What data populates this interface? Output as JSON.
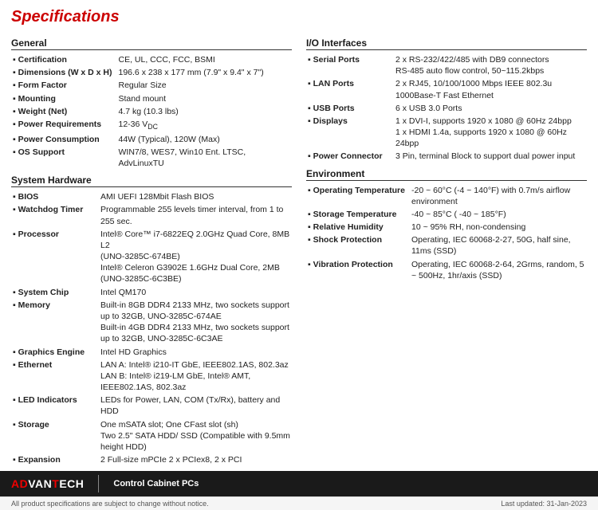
{
  "title": "Specifications",
  "left_col": {
    "sections": [
      {
        "title": "General",
        "rows": [
          {
            "label": "Certification",
            "value": "CE, UL, CCC, FCC, BSMI"
          },
          {
            "label": "Dimensions (W x D x H)",
            "value": "196.6 x 238 x 177 mm (7.9\" x 9.4\" x 7\")"
          },
          {
            "label": "Form Factor",
            "value": "Regular Size"
          },
          {
            "label": "Mounting",
            "value": "Stand mount"
          },
          {
            "label": "Weight (Net)",
            "value": "4.7 kg (10.3 lbs)"
          },
          {
            "label": "Power Requirements",
            "value": "12-36 VDC"
          },
          {
            "label": "Power Consumption",
            "value": "44W (Typical), 120W (Max)"
          },
          {
            "label": "OS Support",
            "value": "WIN7/8, WES7, Win10 Ent. LTSC, AdvLinuxTU"
          }
        ]
      },
      {
        "title": "System Hardware",
        "rows": [
          {
            "label": "BIOS",
            "value": "AMI UEFI 128Mbit Flash BIOS"
          },
          {
            "label": "Watchdog Timer",
            "value": "Programmable 255 levels timer interval, from 1 to 255 sec."
          },
          {
            "label": "Processor",
            "value": "Intel® Core™ i7-6822EQ 2.0GHz Quad Core, 8MB L2\n(UNO-3285C-674BE)\nIntel® Celeron G3902E 1.6GHz Dual Core, 2MB\n(UNO-3285C-6C3BE)"
          },
          {
            "label": "System Chip",
            "value": "Intel QM170"
          },
          {
            "label": "Memory",
            "value": "Built-in 8GB DDR4 2133 MHz, two sockets support up to 32GB, UNO-3285C-674AE\nBuilt-in 4GB DDR4 2133 MHz, two sockets support up to 32GB, UNO-3285C-6C3AE"
          },
          {
            "label": "Graphics Engine",
            "value": "Intel HD Graphics"
          },
          {
            "label": "Ethernet",
            "value": "LAN A: Intel® i210-IT GbE, IEEE802.1AS, 802.3az\nLAN B: Intel® i219-LM GbE, Intel® AMT, IEEE802.1AS, 802.3az"
          },
          {
            "label": "LED Indicators",
            "value": "LEDs for Power, LAN, COM (Tx/Rx), battery and HDD"
          },
          {
            "label": "Storage",
            "value": "One mSATA slot; One CFast slot (sh)\nTwo 2.5\" SATA HDD/ SSD (Compatible with 9.5mm height HDD)"
          },
          {
            "label": "Expansion",
            "value": "2 Full-size mPCIe 2 x PCIex8, 2 x PCI"
          }
        ]
      }
    ]
  },
  "right_col": {
    "sections": [
      {
        "title": "I/O Interfaces",
        "rows": [
          {
            "label": "Serial Ports",
            "value": "2 x RS-232/422/485 with DB9 connectors\nRS-485 auto flow control, 50~115.2kbps"
          },
          {
            "label": "LAN Ports",
            "value": "2 x RJ45, 10/100/1000 Mbps IEEE 802.3u 1000Base-T Fast Ethernet"
          },
          {
            "label": "USB Ports",
            "value": "6 x USB 3.0 Ports"
          },
          {
            "label": "Displays",
            "value": "1 x DVI-I, supports 1920 x 1080 @ 60Hz 24bpp\n1 x HDMI 1.4a, supports 1920 x 1080 @ 60Hz 24bpp"
          },
          {
            "label": "Power Connector",
            "value": "3 Pin, terminal Block to support dual power input"
          }
        ]
      },
      {
        "title": "Environment",
        "rows": [
          {
            "label": "Operating Temperature",
            "value": "-20 ~ 60°C (-4 ~ 140°F) with 0.7m/s airflow environment"
          },
          {
            "label": "Storage Temperature",
            "value": "-40 ~ 85°C ( -40 ~ 185°F)"
          },
          {
            "label": "Relative Humidity",
            "value": "10 ~ 95% RH, non-condensing"
          },
          {
            "label": "Shock Protection",
            "value": "Operating, IEC 60068-2-27, 50G, half sine, 11ms (SSD)"
          },
          {
            "label": "Vibration Protection",
            "value": "Operating, IEC 60068-2-64, 2Grms, random, 5 ~ 500Hz, 1hr/axis (SSD)"
          }
        ]
      }
    ]
  },
  "footer": {
    "logo_adv": "AD",
    "logo_van": "VAN",
    "logo_tech": "TECH",
    "logo_full": "ADVANTECH",
    "product": "Control Cabinet PCs",
    "disclaimer": "All product specifications are subject to change without notice.",
    "last_updated": "Last updated: 31-Jan-2023"
  }
}
